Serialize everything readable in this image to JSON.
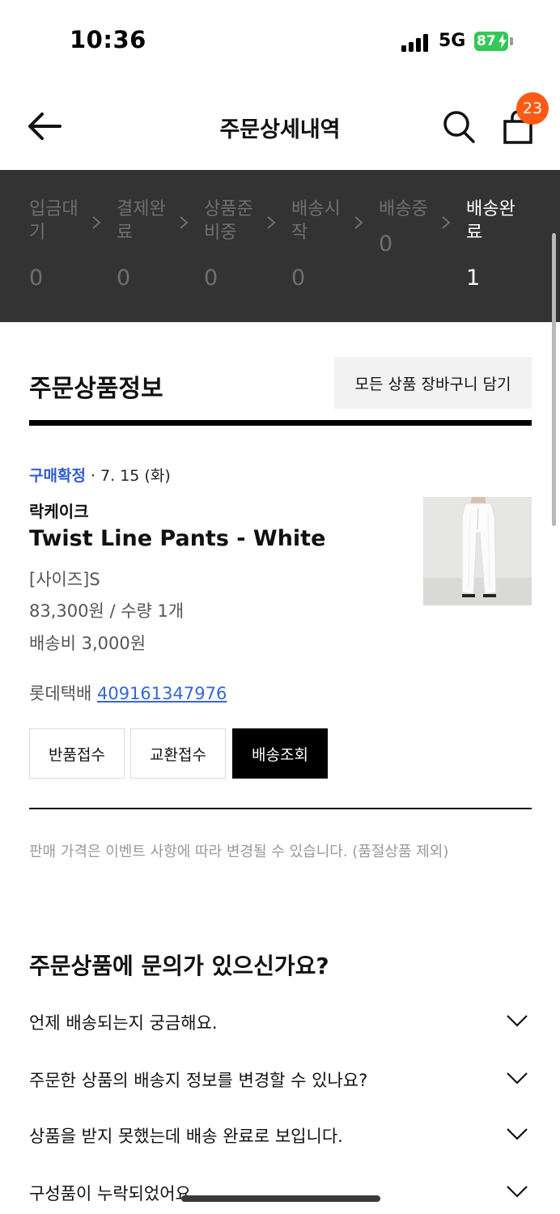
{
  "status_bar": {
    "time": "10:36",
    "network": "5G",
    "battery": "87"
  },
  "header": {
    "title": "주문상세내역",
    "cart_count": "23",
    "icons": [
      "back-arrow-icon",
      "search-icon",
      "shopping-bag-icon"
    ]
  },
  "progress": {
    "steps": [
      {
        "label": "입금대기",
        "count": "0",
        "active": false
      },
      {
        "label": "결제완료",
        "count": "0",
        "active": false
      },
      {
        "label": "상품준비중",
        "count": "0",
        "active": false
      },
      {
        "label": "배송시작",
        "count": "0",
        "active": false
      },
      {
        "label": "배송중",
        "count": "0",
        "active": false
      },
      {
        "label": "배송완료",
        "count": "1",
        "active": true
      }
    ]
  },
  "order_section": {
    "title": "주문상품정보",
    "cart_all_button": "모든 상품 장바구니 담기"
  },
  "item": {
    "status": "구매확정",
    "date": " · 7. 15 (화)",
    "brand": "락케이크",
    "name": "Twist Line Pants - White",
    "option": "[사이즈]S",
    "price_qty": "83,300원 / 수량 1개",
    "shipping_fee": "배송비 3,000원",
    "carrier": "롯데택배 ",
    "tracking_number": "409161347976"
  },
  "actions": {
    "return": "반품접수",
    "exchange": "교환접수",
    "track": "배송조회"
  },
  "price_note": "판매 가격은 이벤트 사항에 따라 변경될 수 있습니다. (품절상품 제외)",
  "faq": {
    "title": "주문상품에 문의가 있으신가요?",
    "items": [
      "언제 배송되는지 궁금해요.",
      "주문한 상품의 배송지 정보를 변경할 수 있나요?",
      "상품을 받지 못했는데 배송 완료로 보입니다.",
      "구성품이 누락되었어요."
    ]
  },
  "colors": {
    "progress_bg": "#333333",
    "accent_blue": "#2f5bd0",
    "badge_orange": "#ff5a14",
    "battery_green": "#34c759"
  }
}
